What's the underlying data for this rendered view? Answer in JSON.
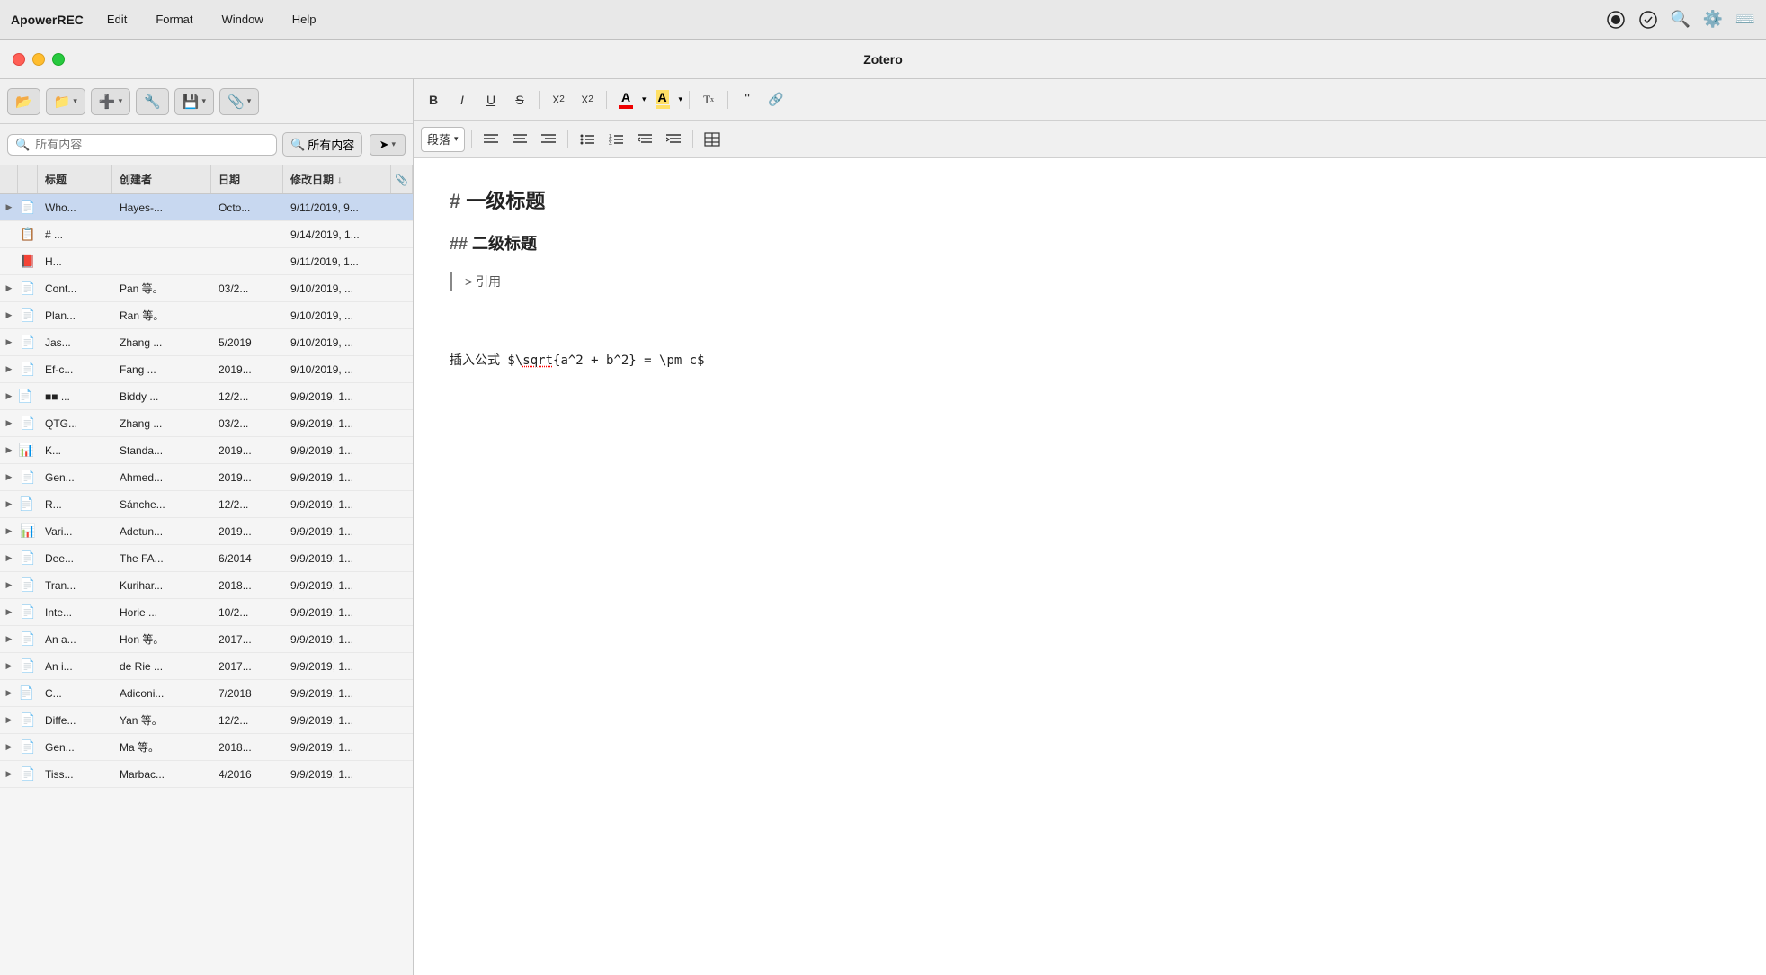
{
  "menubar": {
    "app": "ApowerREC",
    "items": [
      "Edit",
      "Format",
      "Window",
      "Help"
    ]
  },
  "titlebar": {
    "title": "Zotero"
  },
  "toolbar": {
    "buttons": [
      {
        "id": "open",
        "icon": "📂"
      },
      {
        "id": "folder",
        "icon": "📁"
      },
      {
        "id": "add",
        "icon": "➕"
      },
      {
        "id": "tools",
        "icon": "🔧"
      },
      {
        "id": "save",
        "icon": "💾"
      },
      {
        "id": "attach",
        "icon": "📎"
      }
    ]
  },
  "search": {
    "placeholder": "所有内容",
    "icon": "🔍"
  },
  "columns": {
    "title": "标题",
    "creator": "创建者",
    "date": "日期",
    "modified": "修改日期",
    "sort_indicator": "↓"
  },
  "files": [
    {
      "id": 1,
      "indent": 0,
      "expand": true,
      "icon": "doc",
      "tags": [],
      "title": "Who...",
      "creator": "Hayes-...",
      "date": "Octo...",
      "modified": "9/11/2019, 9...",
      "selected": true
    },
    {
      "id": 2,
      "indent": 1,
      "expand": false,
      "icon": "note-orange",
      "tags": [],
      "title": "# ...",
      "creator": "",
      "date": "",
      "modified": "9/14/2019, 1...",
      "selected": false
    },
    {
      "id": 3,
      "indent": 1,
      "expand": false,
      "icon": "pdf",
      "tags": [],
      "title": "H...",
      "creator": "",
      "date": "",
      "modified": "9/11/2019, 1...",
      "selected": false
    },
    {
      "id": 4,
      "indent": 0,
      "expand": true,
      "icon": "doc",
      "tags": [],
      "title": "Cont...",
      "creator": "Pan 等。",
      "date": "03/2...",
      "modified": "9/10/2019, ...",
      "selected": false
    },
    {
      "id": 5,
      "indent": 0,
      "expand": true,
      "icon": "doc",
      "tags": [],
      "title": "Plan...",
      "creator": "Ran 等。",
      "date": "",
      "modified": "9/10/2019, ...",
      "selected": false
    },
    {
      "id": 6,
      "indent": 0,
      "expand": true,
      "icon": "doc",
      "tags": [],
      "title": "Jas...",
      "creator": "Zhang ...",
      "date": "5/2019",
      "modified": "9/10/2019, ...",
      "selected": false
    },
    {
      "id": 7,
      "indent": 0,
      "expand": true,
      "icon": "doc",
      "tags": [],
      "title": "Ef-c...",
      "creator": "Fang ...",
      "date": "2019...",
      "modified": "9/10/2019, ...",
      "selected": false
    },
    {
      "id": 8,
      "indent": 0,
      "expand": true,
      "icon": "doc",
      "tags": [
        "blue",
        "red"
      ],
      "title": "■■ ...",
      "creator": "Biddy ...",
      "date": "12/2...",
      "modified": "9/9/2019, 1...",
      "selected": false
    },
    {
      "id": 9,
      "indent": 0,
      "expand": true,
      "icon": "doc",
      "tags": [],
      "title": "QTG...",
      "creator": "Zhang ...",
      "date": "03/2...",
      "modified": "9/9/2019, 1...",
      "selected": false
    },
    {
      "id": 10,
      "indent": 0,
      "expand": true,
      "icon": "doc-bar",
      "tags": [
        "red"
      ],
      "title": "K...",
      "creator": "Standa...",
      "date": "2019...",
      "modified": "9/9/2019, 1...",
      "selected": false
    },
    {
      "id": 11,
      "indent": 0,
      "expand": true,
      "icon": "doc",
      "tags": [],
      "title": "Gen...",
      "creator": "Ahmed...",
      "date": "2019...",
      "modified": "9/9/2019, 1...",
      "selected": false
    },
    {
      "id": 12,
      "indent": 0,
      "expand": true,
      "icon": "doc",
      "tags": [
        "red"
      ],
      "title": "R...",
      "creator": "Sánche...",
      "date": "12/2...",
      "modified": "9/9/2019, 1...",
      "selected": false
    },
    {
      "id": 13,
      "indent": 0,
      "expand": true,
      "icon": "doc-bar",
      "tags": [],
      "title": "Vari...",
      "creator": "Adetun...",
      "date": "2019...",
      "modified": "9/9/2019, 1...",
      "selected": false
    },
    {
      "id": 14,
      "indent": 0,
      "expand": true,
      "icon": "doc",
      "tags": [],
      "title": "Dee...",
      "creator": "The FA...",
      "date": "6/2014",
      "modified": "9/9/2019, 1...",
      "selected": false
    },
    {
      "id": 15,
      "indent": 0,
      "expand": true,
      "icon": "doc",
      "tags": [],
      "title": "Tran...",
      "creator": "Kurihar...",
      "date": "2018...",
      "modified": "9/9/2019, 1...",
      "selected": false
    },
    {
      "id": 16,
      "indent": 0,
      "expand": true,
      "icon": "doc",
      "tags": [],
      "title": "Inte...",
      "creator": "Horie ...",
      "date": "10/2...",
      "modified": "9/9/2019, 1...",
      "selected": false
    },
    {
      "id": 17,
      "indent": 0,
      "expand": true,
      "icon": "doc",
      "tags": [],
      "title": "An a...",
      "creator": "Hon 等。",
      "date": "2017...",
      "modified": "9/9/2019, 1...",
      "selected": false
    },
    {
      "id": 18,
      "indent": 0,
      "expand": true,
      "icon": "doc",
      "tags": [],
      "title": "An i...",
      "creator": "de Rie ...",
      "date": "2017...",
      "modified": "9/9/2019, 1...",
      "selected": false
    },
    {
      "id": 19,
      "indent": 0,
      "expand": true,
      "icon": "doc",
      "tags": [
        "red"
      ],
      "title": "C...",
      "creator": "Adiconi...",
      "date": "7/2018",
      "modified": "9/9/2019, 1...",
      "selected": false
    },
    {
      "id": 20,
      "indent": 0,
      "expand": true,
      "icon": "doc",
      "tags": [],
      "title": "Diffe...",
      "creator": "Yan 等。",
      "date": "12/2...",
      "modified": "9/9/2019, 1...",
      "selected": false
    },
    {
      "id": 21,
      "indent": 0,
      "expand": true,
      "icon": "doc",
      "tags": [],
      "title": "Gen...",
      "creator": "Ma 等。",
      "date": "2018...",
      "modified": "9/9/2019, 1...",
      "selected": false
    },
    {
      "id": 22,
      "indent": 0,
      "expand": true,
      "icon": "doc",
      "tags": [],
      "title": "Tiss...",
      "creator": "Marbac...",
      "date": "4/2016",
      "modified": "9/9/2019, 1...",
      "selected": false
    }
  ],
  "editor": {
    "toolbar": {
      "bold": "B",
      "italic": "I",
      "underline": "U",
      "strikethrough": "S",
      "sub": "X₂",
      "sup": "X²",
      "font_color": "A",
      "highlight_color": "A",
      "clear": "Tx",
      "quote": "❝",
      "link": "🔗",
      "paragraph_label": "段落",
      "align_left": "≡",
      "align_center": "≡",
      "align_right": "≡",
      "list_bullet": "☰",
      "list_num": "☰",
      "indent_dec": "☰",
      "indent_inc": "☰",
      "insert_table": "⊞"
    },
    "content": {
      "h1_prefix": "# ",
      "h1_text": "一级标题",
      "h2_prefix": "## ",
      "h2_text": "二级标题",
      "quote_prefix": "> ",
      "quote_text": "引用",
      "formula_prefix": "插入公式 $\\sqrt{a^2 + b^2} = \\pm c$"
    }
  }
}
